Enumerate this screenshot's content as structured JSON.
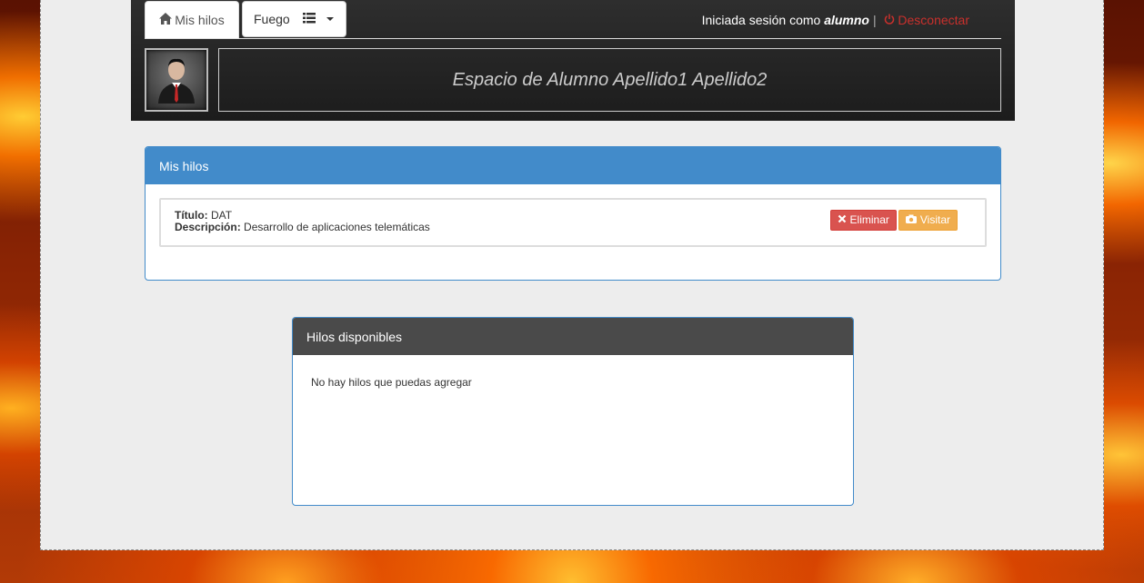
{
  "nav": {
    "home_tab": "Mis hilos",
    "fuego_tab": "Fuego",
    "session_prefix": "Iniciada sesión como",
    "session_user": "alumno",
    "separator": "|",
    "logout_label": "Desconectar"
  },
  "banner": {
    "title": "Espacio de Alumno Apellido1 Apellido2"
  },
  "my_threads": {
    "heading": "Mis hilos",
    "items": [
      {
        "title_label": "Título:",
        "title_value": "DAT",
        "desc_label": "Descripción:",
        "desc_value": "Desarrollo de aplicaciones telemáticas",
        "delete_label": "Eliminar",
        "visit_label": "Visitar"
      }
    ]
  },
  "available_threads": {
    "heading": "Hilos disponibles",
    "empty_message": "No hay hilos que puedas agregar"
  },
  "icons": {
    "home": "home-icon",
    "list": "list-icon",
    "caret": "caret-down-icon",
    "power": "power-icon",
    "close": "close-icon",
    "camera": "camera-icon",
    "avatar": "user-avatar"
  },
  "colors": {
    "primary": "#428bca",
    "danger": "#d9534f",
    "warning": "#f0ad4e",
    "dark_panel": "#4a4a4a"
  }
}
